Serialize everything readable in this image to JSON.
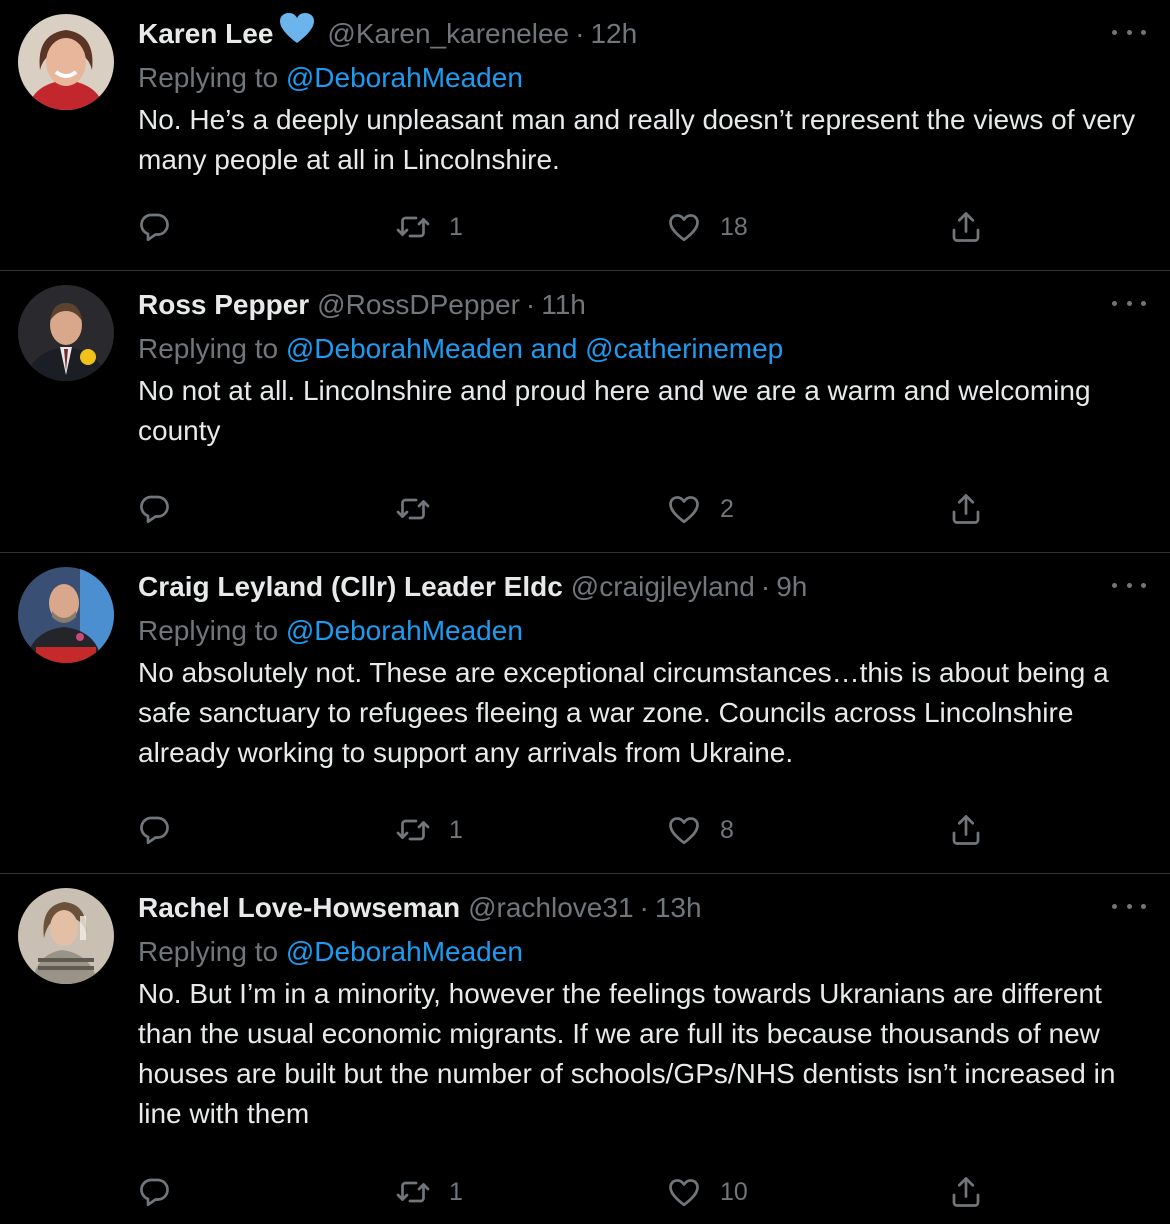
{
  "tweets": [
    {
      "name": "Karen Lee",
      "verified_heart": true,
      "handle": "@Karen_karenelee",
      "separator": "·",
      "time": "12h",
      "replying_prefix": "Replying to",
      "replying_to": [
        "@DeborahMeaden"
      ],
      "replying_joiner": "",
      "text": "No. He’s a deeply unpleasant man and really doesn’t represent the views of very many people at all in Lincolnshire.",
      "retweets": "1",
      "likes": "18"
    },
    {
      "name": "Ross Pepper",
      "handle": "@RossDPepper",
      "separator": "·",
      "time": "11h",
      "replying_prefix": "Replying to",
      "replying_to": [
        "@DeborahMeaden",
        "@catherinemep"
      ],
      "replying_joiner": "and",
      "text": "No not at all. Lincolnshire and proud here and we are a warm and welcoming county",
      "retweets": "",
      "likes": "2"
    },
    {
      "name": "Craig Leyland (Cllr) Leader Eldc",
      "handle": "@craigjleyland",
      "separator": "·",
      "time": "9h",
      "replying_prefix": "Replying to",
      "replying_to": [
        "@DeborahMeaden"
      ],
      "replying_joiner": "",
      "text": "No absolutely not. These are exceptional circumstances…this is about being a safe sanctuary to refugees fleeing a war zone. Councils across Lincolnshire already working to support any arrivals from Ukraine.",
      "retweets": "1",
      "likes": "8"
    },
    {
      "name": "Rachel Love-Howseman",
      "handle": "@rachlove31",
      "separator": "·",
      "time": "13h",
      "replying_prefix": "Replying to",
      "replying_to": [
        "@DeborahMeaden"
      ],
      "replying_joiner": "",
      "text": "No. But I’m in a minority, however the feelings towards Ukranians are different than the usual economic migrants. If we are full its because thousands of new houses are built but the number of schools/GPs/NHS dentists isn’t increased in line with them",
      "retweets": "1",
      "likes": "10"
    }
  ],
  "icons": {
    "reply": "reply-bubble-icon",
    "retweet": "retweet-icon",
    "like": "heart-outline-icon",
    "share": "share-upload-icon",
    "more": "more-dots-icon",
    "verified": "blue-heart-icon"
  },
  "colors": {
    "background": "#000000",
    "text": "#e7e9ea",
    "muted": "#71767b",
    "link": "#1d9bf0",
    "divider": "#2f3336",
    "heart_badge": "#6cb5ec"
  }
}
